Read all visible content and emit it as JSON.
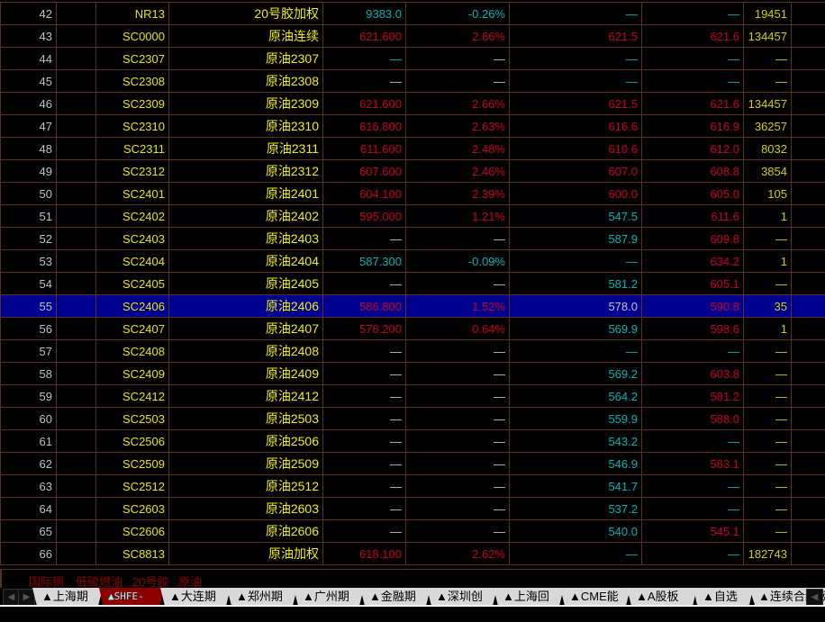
{
  "colors": {
    "red": "#c8001e",
    "cyan": "#00b4b4",
    "yellow": "#e6e600",
    "selected_row_bg": "#000090",
    "grid": "#5a3020"
  },
  "selected_row": "55",
  "rows": [
    {
      "no": "42",
      "code": "NR13",
      "name": "20号胶加权",
      "price": [
        "9383.0",
        "c"
      ],
      "change": [
        "-0.26%",
        "c"
      ],
      "bid": [
        "—",
        "c"
      ],
      "ask": [
        "—",
        "c"
      ],
      "vol": [
        "19451",
        "y"
      ]
    },
    {
      "no": "43",
      "code": "SC0000",
      "name": "原油连续",
      "price": [
        "621.600",
        "r"
      ],
      "change": [
        "2.66%",
        "r"
      ],
      "bid": [
        "621.5",
        "r"
      ],
      "ask": [
        "621.6",
        "r"
      ],
      "vol": [
        "134457",
        "y"
      ]
    },
    {
      "no": "44",
      "code": "SC2307",
      "name": "原油2307",
      "price": [
        "—",
        "c"
      ],
      "change": [
        "—",
        "w"
      ],
      "bid": [
        "—",
        "c"
      ],
      "ask": [
        "—",
        "c"
      ],
      "vol": [
        "—",
        "y"
      ]
    },
    {
      "no": "45",
      "code": "SC2308",
      "name": "原油2308",
      "price": [
        "—",
        "w"
      ],
      "change": [
        "—",
        "w"
      ],
      "bid": [
        "—",
        "c"
      ],
      "ask": [
        "—",
        "c"
      ],
      "vol": [
        "—",
        "y"
      ]
    },
    {
      "no": "46",
      "code": "SC2309",
      "name": "原油2309",
      "price": [
        "621.600",
        "r"
      ],
      "change": [
        "2.66%",
        "r"
      ],
      "bid": [
        "621.5",
        "r"
      ],
      "ask": [
        "621.6",
        "r"
      ],
      "vol": [
        "134457",
        "y"
      ]
    },
    {
      "no": "47",
      "code": "SC2310",
      "name": "原油2310",
      "price": [
        "616.800",
        "r"
      ],
      "change": [
        "2.63%",
        "r"
      ],
      "bid": [
        "616.6",
        "r"
      ],
      "ask": [
        "616.9",
        "r"
      ],
      "vol": [
        "36257",
        "y"
      ]
    },
    {
      "no": "48",
      "code": "SC2311",
      "name": "原油2311",
      "price": [
        "611.600",
        "r"
      ],
      "change": [
        "2.48%",
        "r"
      ],
      "bid": [
        "610.6",
        "r"
      ],
      "ask": [
        "612.0",
        "r"
      ],
      "vol": [
        "8032",
        "y"
      ]
    },
    {
      "no": "49",
      "code": "SC2312",
      "name": "原油2312",
      "price": [
        "607.600",
        "r"
      ],
      "change": [
        "2.46%",
        "r"
      ],
      "bid": [
        "607.0",
        "r"
      ],
      "ask": [
        "608.8",
        "r"
      ],
      "vol": [
        "3854",
        "y"
      ]
    },
    {
      "no": "50",
      "code": "SC2401",
      "name": "原油2401",
      "price": [
        "604.100",
        "r"
      ],
      "change": [
        "2.39%",
        "r"
      ],
      "bid": [
        "600.0",
        "r"
      ],
      "ask": [
        "605.0",
        "r"
      ],
      "vol": [
        "105",
        "y"
      ]
    },
    {
      "no": "51",
      "code": "SC2402",
      "name": "原油2402",
      "price": [
        "595.000",
        "r"
      ],
      "change": [
        "1.21%",
        "r"
      ],
      "bid": [
        "547.5",
        "c"
      ],
      "ask": [
        "611.6",
        "r"
      ],
      "vol": [
        "1",
        "y"
      ]
    },
    {
      "no": "52",
      "code": "SC2403",
      "name": "原油2403",
      "price": [
        "—",
        "w"
      ],
      "change": [
        "—",
        "w"
      ],
      "bid": [
        "587.9",
        "c"
      ],
      "ask": [
        "609.8",
        "r"
      ],
      "vol": [
        "—",
        "y"
      ]
    },
    {
      "no": "53",
      "code": "SC2404",
      "name": "原油2404",
      "price": [
        "587.300",
        "c"
      ],
      "change": [
        "-0.09%",
        "c"
      ],
      "bid": [
        "—",
        "c"
      ],
      "ask": [
        "634.2",
        "r"
      ],
      "vol": [
        "1",
        "y"
      ]
    },
    {
      "no": "54",
      "code": "SC2405",
      "name": "原油2405",
      "price": [
        "—",
        "w"
      ],
      "change": [
        "—",
        "w"
      ],
      "bid": [
        "581.2",
        "c"
      ],
      "ask": [
        "605.1",
        "r"
      ],
      "vol": [
        "—",
        "y"
      ]
    },
    {
      "no": "55",
      "code": "SC2406",
      "name": "原油2406",
      "price": [
        "586.800",
        "r"
      ],
      "change": [
        "1.52%",
        "r"
      ],
      "bid": [
        "578.0",
        "g"
      ],
      "ask": [
        "590.8",
        "r"
      ],
      "vol": [
        "35",
        "y"
      ]
    },
    {
      "no": "56",
      "code": "SC2407",
      "name": "原油2407",
      "price": [
        "578.200",
        "r"
      ],
      "change": [
        "0.64%",
        "r"
      ],
      "bid": [
        "569.9",
        "c"
      ],
      "ask": [
        "598.6",
        "r"
      ],
      "vol": [
        "1",
        "y"
      ]
    },
    {
      "no": "57",
      "code": "SC2408",
      "name": "原油2408",
      "price": [
        "—",
        "w"
      ],
      "change": [
        "—",
        "w"
      ],
      "bid": [
        "—",
        "c"
      ],
      "ask": [
        "—",
        "c"
      ],
      "vol": [
        "—",
        "y"
      ]
    },
    {
      "no": "58",
      "code": "SC2409",
      "name": "原油2409",
      "price": [
        "—",
        "w"
      ],
      "change": [
        "—",
        "w"
      ],
      "bid": [
        "569.2",
        "c"
      ],
      "ask": [
        "603.8",
        "r"
      ],
      "vol": [
        "—",
        "y"
      ]
    },
    {
      "no": "59",
      "code": "SC2412",
      "name": "原油2412",
      "price": [
        "—",
        "w"
      ],
      "change": [
        "—",
        "w"
      ],
      "bid": [
        "564.2",
        "c"
      ],
      "ask": [
        "581.2",
        "r"
      ],
      "vol": [
        "—",
        "y"
      ]
    },
    {
      "no": "60",
      "code": "SC2503",
      "name": "原油2503",
      "price": [
        "—",
        "w"
      ],
      "change": [
        "—",
        "w"
      ],
      "bid": [
        "559.9",
        "c"
      ],
      "ask": [
        "588.0",
        "r"
      ],
      "vol": [
        "—",
        "y"
      ]
    },
    {
      "no": "61",
      "code": "SC2506",
      "name": "原油2506",
      "price": [
        "—",
        "w"
      ],
      "change": [
        "—",
        "w"
      ],
      "bid": [
        "543.2",
        "c"
      ],
      "ask": [
        "—",
        "c"
      ],
      "vol": [
        "—",
        "y"
      ]
    },
    {
      "no": "62",
      "code": "SC2509",
      "name": "原油2509",
      "price": [
        "—",
        "w"
      ],
      "change": [
        "—",
        "w"
      ],
      "bid": [
        "546.9",
        "c"
      ],
      "ask": [
        "583.1",
        "r"
      ],
      "vol": [
        "—",
        "y"
      ]
    },
    {
      "no": "63",
      "code": "SC2512",
      "name": "原油2512",
      "price": [
        "—",
        "w"
      ],
      "change": [
        "—",
        "w"
      ],
      "bid": [
        "541.7",
        "c"
      ],
      "ask": [
        "—",
        "c"
      ],
      "vol": [
        "—",
        "y"
      ]
    },
    {
      "no": "64",
      "code": "SC2603",
      "name": "原油2603",
      "price": [
        "—",
        "w"
      ],
      "change": [
        "—",
        "w"
      ],
      "bid": [
        "537.2",
        "c"
      ],
      "ask": [
        "—",
        "c"
      ],
      "vol": [
        "—",
        "y"
      ]
    },
    {
      "no": "65",
      "code": "SC2606",
      "name": "原油2606",
      "price": [
        "—",
        "w"
      ],
      "change": [
        "—",
        "w"
      ],
      "bid": [
        "540.0",
        "c"
      ],
      "ask": [
        "545.1",
        "r"
      ],
      "vol": [
        "—",
        "y"
      ]
    },
    {
      "no": "66",
      "code": "SC8813",
      "name": "原油加权",
      "price": [
        "618.100",
        "r"
      ],
      "change": [
        "2.62%",
        "r"
      ],
      "bid": [
        "—",
        "c"
      ],
      "ask": [
        "—",
        "c"
      ],
      "vol": [
        "182743",
        "y"
      ]
    }
  ],
  "categories": [
    "国际铜",
    "低硫燃油",
    "20号胶",
    "原油"
  ],
  "tabs": [
    "▲上海期货",
    "▲SHFE-INE",
    "▲大连期货",
    "▲郑州期货",
    "▲广州期货",
    "▲金融期货",
    "▲深圳创业",
    "▲上海回购",
    "▲CME能源",
    "▲A股板块",
    "▲自选股",
    "▲连续合约板块"
  ],
  "active_tab": "▲SHFE-INE",
  "nav": {
    "left": "◀",
    "right": "▶"
  }
}
